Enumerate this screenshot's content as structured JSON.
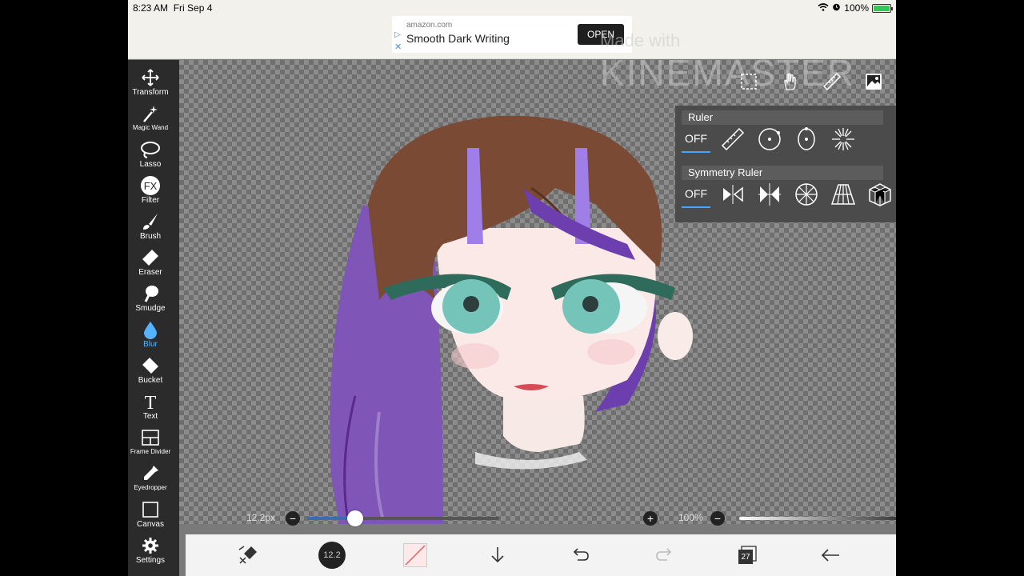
{
  "status": {
    "time": "8:23 AM",
    "date": "Fri Sep 4",
    "battery_label": "100%",
    "battery_level": 1.0
  },
  "ad": {
    "domain": "amazon.com",
    "title": "Smooth Dark Writing",
    "button": "OPEN"
  },
  "watermark": {
    "made_with": "Made with",
    "brand": "KINEMASTER"
  },
  "tools": [
    {
      "label": "Transform",
      "icon": "move-icon"
    },
    {
      "label": "Magic Wand",
      "icon": "magic-wand-icon"
    },
    {
      "label": "Lasso",
      "icon": "lasso-icon"
    },
    {
      "label": "Filter",
      "icon": "fx-icon"
    },
    {
      "label": "Brush",
      "icon": "brush-icon"
    },
    {
      "label": "Eraser",
      "icon": "eraser-icon"
    },
    {
      "label": "Smudge",
      "icon": "smudge-icon"
    },
    {
      "label": "Blur",
      "icon": "droplet-icon"
    },
    {
      "label": "Bucket",
      "icon": "bucket-icon"
    },
    {
      "label": "Text",
      "icon": "text-icon"
    },
    {
      "label": "Frame Divider",
      "icon": "frame-divider-icon"
    },
    {
      "label": "Eyedropper",
      "icon": "eyedropper-icon"
    },
    {
      "label": "Canvas",
      "icon": "canvas-icon"
    },
    {
      "label": "Settings",
      "icon": "gear-icon"
    }
  ],
  "active_tool": "Blur",
  "ruler": {
    "title": "Ruler",
    "off": "OFF"
  },
  "symmetry": {
    "title": "Symmetry Ruler",
    "off": "OFF"
  },
  "brush_size": {
    "label": "12.2px",
    "value": 0.25
  },
  "opacity": {
    "label": "100%",
    "value": 1.0
  },
  "bottom": {
    "brush_size_badge": "12.2",
    "layer_count": "27"
  },
  "colors": {
    "accent": "#4aa3ff",
    "toolbar_bg": "#2b2b2b",
    "active_tool": "#55b4ff"
  }
}
